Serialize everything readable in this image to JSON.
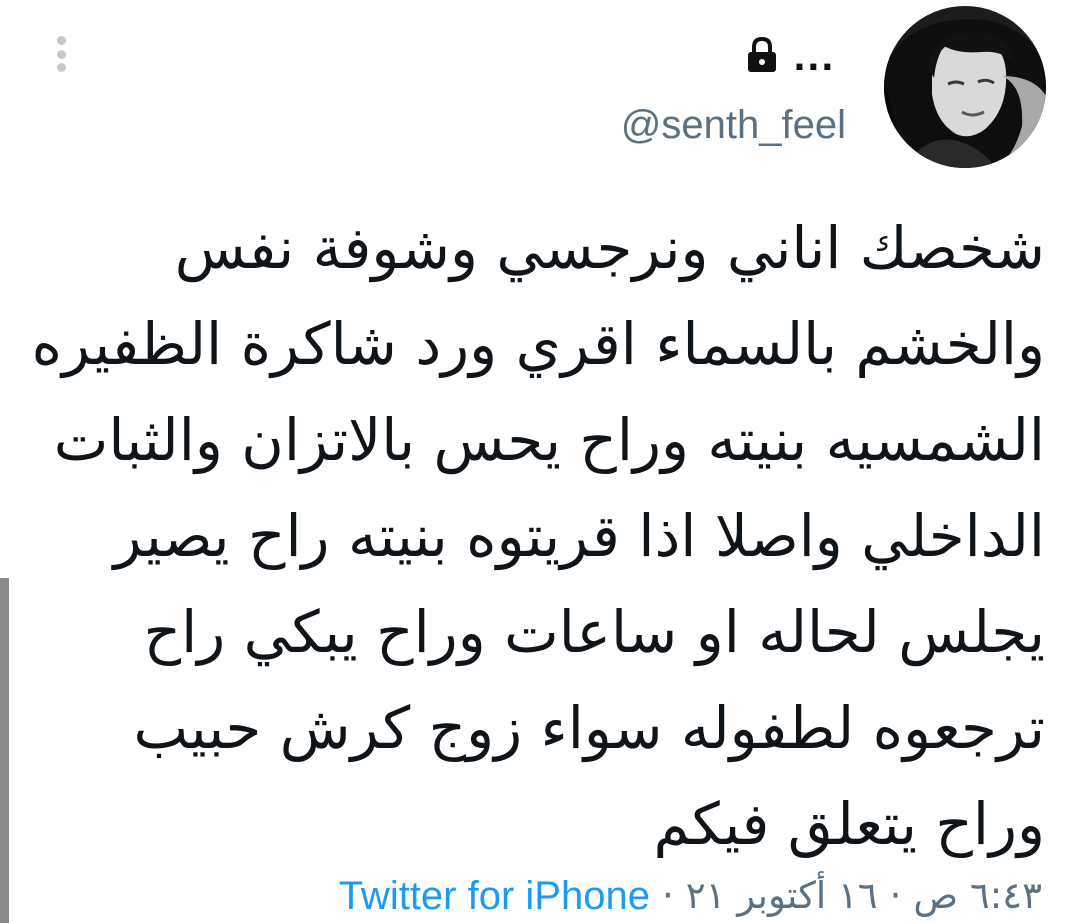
{
  "tweet": {
    "handle": "@senth_feel",
    "protected_icon": "lock-icon",
    "more_icon": "more-horizontal-icon",
    "more_text": "...",
    "lines": [
      "شخصك اناني ونرجسي وشوفة نفس",
      "والخشم بالسماء اقري ورد شاكرة الظفيره",
      "الشمسيه بنيته وراح يحس بالاتزان والثبات",
      "الداخلي واصلا اذا قريتوه بنيته راح يصير",
      "يجلس لحاله او ساعات وراح يبكي راح",
      "ترجعوه لطفوله سواء زوج كرش حبيب",
      "وراح يتعلق فيكم"
    ],
    "time": "٦:٤٣ ص",
    "date": "١٦ أكتوبر ٢١",
    "separator": "·",
    "source": "Twitter for iPhone"
  },
  "app": {
    "menu_icon": "more-vertical-icon"
  },
  "colors": {
    "text": "#0f1419",
    "secondary": "#5b7083",
    "link": "#1d9bf0",
    "kebab": "#c3c9cf"
  }
}
